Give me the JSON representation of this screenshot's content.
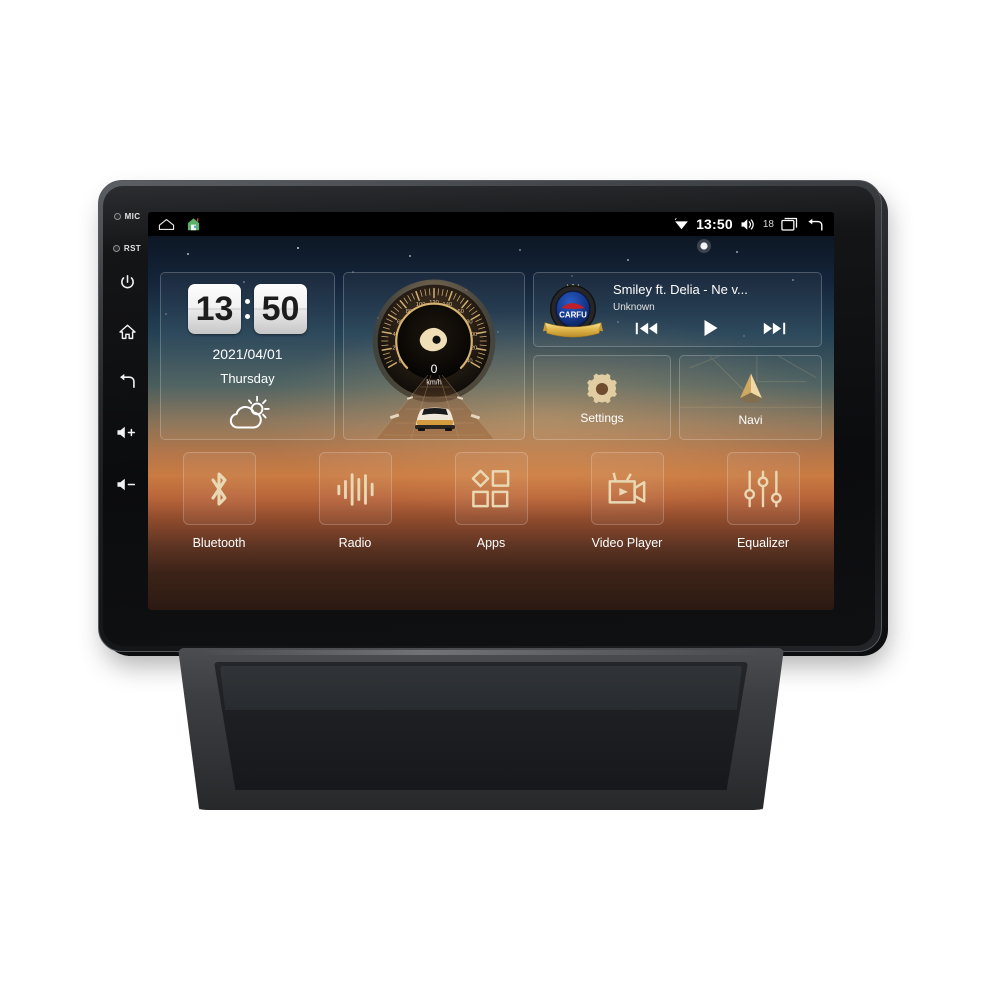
{
  "device": {
    "name": "Android Car Stereo Head Unit",
    "bezel_buttons": [
      {
        "id": "mic",
        "label": "MIC",
        "type": "indicator"
      },
      {
        "id": "rst",
        "label": "RST",
        "type": "indicator"
      },
      {
        "id": "power",
        "label": "",
        "icon": "power-icon"
      },
      {
        "id": "home",
        "label": "",
        "icon": "home-icon"
      },
      {
        "id": "back",
        "label": "",
        "icon": "back-arrow-icon"
      },
      {
        "id": "volume-up",
        "label": "",
        "icon": "volume-up-icon"
      },
      {
        "id": "volume-down",
        "label": "",
        "icon": "volume-down-icon"
      }
    ]
  },
  "statusbar": {
    "left_icons": [
      "home-outline-icon",
      "house-app-icon"
    ],
    "wifi_icon": "wifi-icon",
    "clock": "13:50",
    "volume_icon": "volume-icon",
    "volume_level": "18",
    "recents_icon": "recents-icon",
    "back_icon": "back-arrow-icon"
  },
  "clock_widget": {
    "hours": "13",
    "minutes": "50",
    "date": "2021/04/01",
    "weekday": "Thursday",
    "weather_icon": "sun-cloud-icon"
  },
  "speedometer_widget": {
    "value": "0",
    "unit": "km/h",
    "ticks": [
      "0",
      "20",
      "40",
      "60",
      "80",
      "100",
      "120",
      "140",
      "160",
      "180",
      "200",
      "220",
      "240"
    ],
    "min": 0,
    "max": 240
  },
  "media_widget": {
    "logo_text": "CARFU",
    "track_title": "Smiley ft. Delia - Ne v...",
    "artist": "Unknown",
    "controls": [
      {
        "name": "previous-track-button",
        "icon": "skip-previous-icon"
      },
      {
        "name": "play-button",
        "icon": "play-icon"
      },
      {
        "name": "next-track-button",
        "icon": "skip-next-icon"
      }
    ]
  },
  "tiles": [
    {
      "label": "Settings",
      "icon": "gear-icon"
    },
    {
      "label": "Navi",
      "icon": "navigation-arrow-icon"
    }
  ],
  "dock_apps": [
    {
      "label": "Bluetooth",
      "icon": "bluetooth-icon"
    },
    {
      "label": "Radio",
      "icon": "radio-waves-icon"
    },
    {
      "label": "Apps",
      "icon": "apps-grid-icon"
    },
    {
      "label": "Video Player",
      "icon": "video-camera-icon"
    },
    {
      "label": "Equalizer",
      "icon": "equalizer-sliders-icon"
    }
  ],
  "colors": {
    "accent_gold": "#e6c98a",
    "screen_text": "#ffffff",
    "sky_top": "#0d1724",
    "sunset": "#c97b42",
    "ground": "#2b1a12",
    "chassis": "#303337",
    "logo_blue": "#15388c",
    "logo_red": "#c01f2a",
    "ribbon_gold": "#e8bf55"
  }
}
